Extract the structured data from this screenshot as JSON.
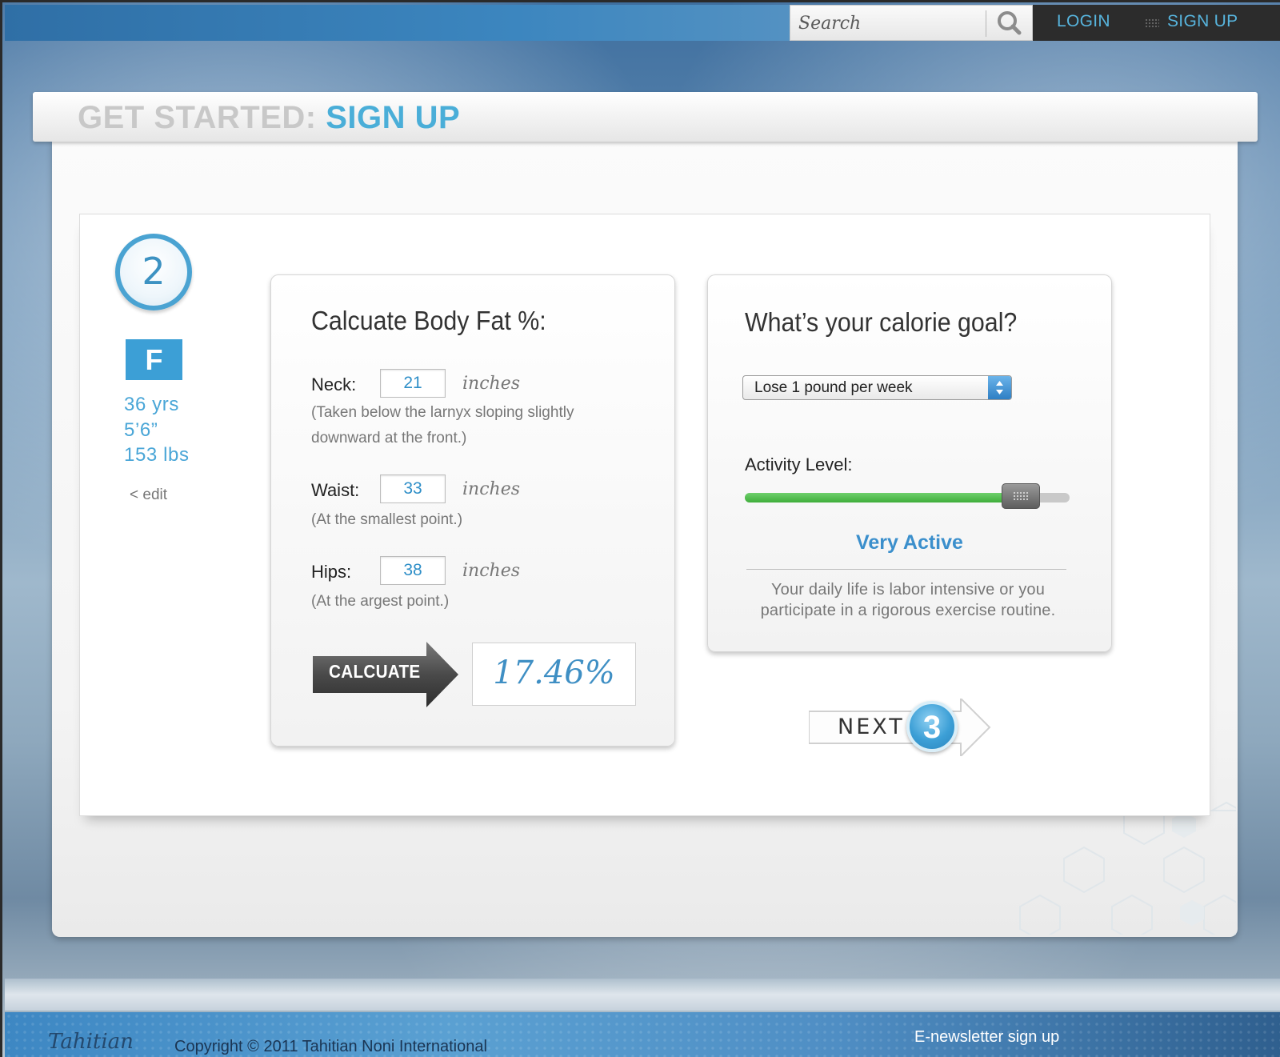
{
  "topbar": {
    "search_placeholder": "Search",
    "login_label": "LOGIN",
    "signup_label": "SIGN UP"
  },
  "header": {
    "title_prefix": "GET STARTED:",
    "title_main": "SIGN UP"
  },
  "profile": {
    "step_number": "2",
    "gender": "F",
    "age": "36 yrs",
    "height": "5’6”",
    "weight": "153 lbs",
    "edit_label": "< edit"
  },
  "body_fat": {
    "title": "Calcuate Body Fat %:",
    "neck": {
      "label": "Neck:",
      "value": "21",
      "unit": "inches",
      "hint_line1": "(Taken below the larnyx sloping slightly",
      "hint_line2": "downward at the front.)"
    },
    "waist": {
      "label": "Waist:",
      "value": "33",
      "unit": "inches",
      "hint": "(At the smallest point.)"
    },
    "hips": {
      "label": "Hips:",
      "value": "38",
      "unit": "inches",
      "hint": "(At the argest point.)"
    },
    "calculate_label": "CALCUATE",
    "result": "17.46%"
  },
  "calorie_goal": {
    "title": "What’s your calorie goal?",
    "selected_goal": "Lose 1 pound per week",
    "activity_label": "Activity Level:",
    "activity_fraction": 0.85,
    "activity_name": "Very Active",
    "activity_desc_line1": "Your daily life is labor intensive or you",
    "activity_desc_line2": "participate in a rigorous exercise routine."
  },
  "next": {
    "label": "NEXT",
    "step_number": "3"
  },
  "footer": {
    "logo_text": "Tahitian",
    "copyright": "Copyright © 2011 Tahitian Noni International",
    "newsletter": "E-newsletter sign up"
  },
  "colors": {
    "accent_blue": "#4aaed8",
    "nav_blue": "#57b4dd",
    "slider_green": "#3fae3b"
  }
}
